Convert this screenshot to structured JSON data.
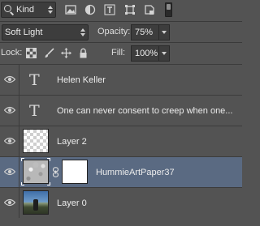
{
  "filter": {
    "kind_label": "Kind",
    "icons": [
      "image-filter-icon",
      "adjustment-filter-icon",
      "type-filter-icon",
      "shape-filter-icon",
      "smart-object-filter-icon"
    ]
  },
  "blend": {
    "mode": "Soft Light",
    "opacity_label": "Opacity:",
    "opacity_value": "75%"
  },
  "lock": {
    "label": "Lock:",
    "fill_label": "Fill:",
    "fill_value": "100%"
  },
  "layers": [
    {
      "name": "Helen Keller",
      "kind": "type",
      "selected": false
    },
    {
      "name": "One can never consent to creep when one...",
      "kind": "type",
      "selected": false
    },
    {
      "name": "Layer 2",
      "kind": "pixel",
      "selected": false
    },
    {
      "name": "HummieArtPaper37",
      "kind": "masked",
      "selected": true
    },
    {
      "name": "Layer 0",
      "kind": "photo",
      "selected": false
    }
  ],
  "colors": {
    "panel_bg": "#535353",
    "field_bg": "#3d3d3d",
    "selected_row": "#5a6a82"
  }
}
